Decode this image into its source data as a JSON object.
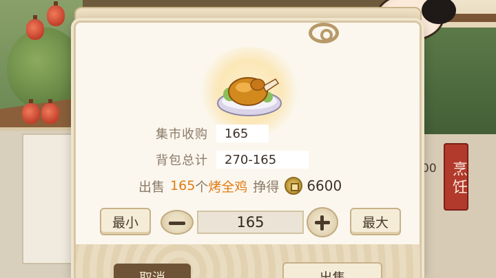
{
  "dialog": {
    "market_label": "集市收购",
    "market_value": "165",
    "bag_label": "背包总计",
    "bag_value": "270-165",
    "sell_prefix": "出售",
    "sell_count": "165",
    "sell_unit": "个",
    "item_name": "烤全鸡",
    "earn_label": "挣得",
    "earn_amount": "6600",
    "coin_icon": "copper-coin-icon",
    "min_label": "最小",
    "max_label": "最大",
    "quantity": "165",
    "cancel_label": "取消",
    "sell_label": "出售"
  },
  "side": {
    "cook_tag": "烹饪",
    "partial_number": "00"
  },
  "colors": {
    "highlight": "#e07a14",
    "label": "#8b7a68",
    "panel": "#fbf7ee",
    "cook_tag": "#b23a2c"
  }
}
